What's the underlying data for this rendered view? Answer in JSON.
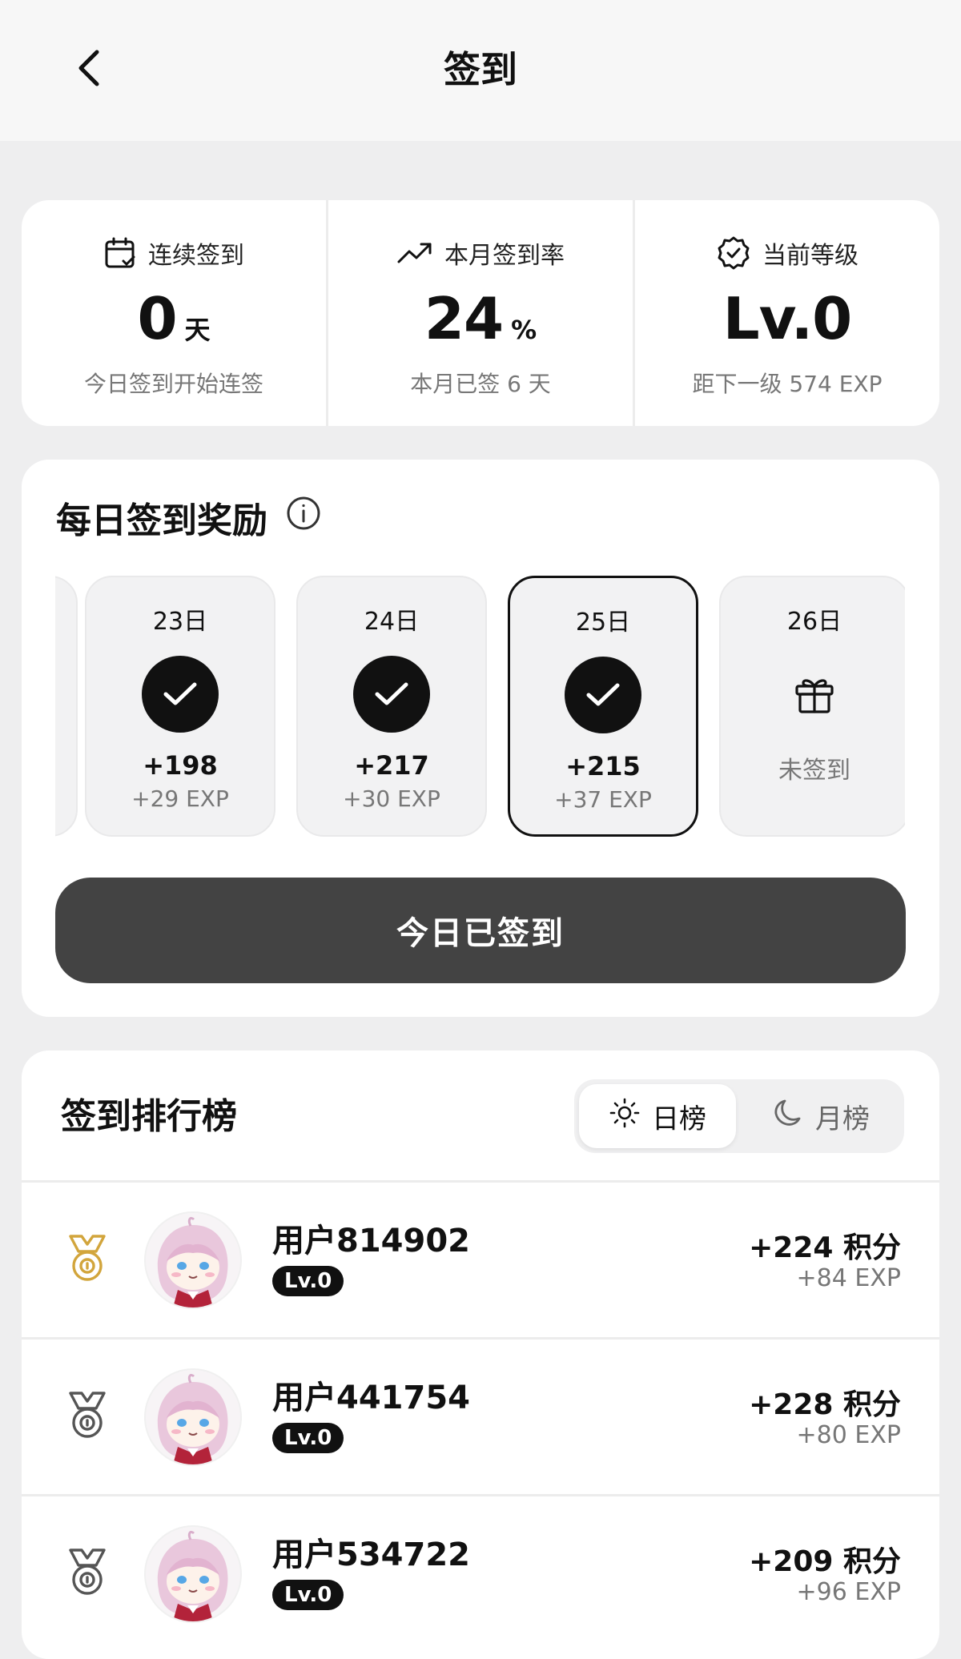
{
  "header": {
    "title": "签到",
    "back_icon": "chevron-left-icon"
  },
  "stats": [
    {
      "icon": "calendar-check-icon",
      "label": "连续签到",
      "value": "0",
      "unit": "天",
      "sub": "今日签到开始连签"
    },
    {
      "icon": "trending-up-icon",
      "label": "本月签到率",
      "value": "24",
      "unit": "%",
      "sub": "本月已签 6 天"
    },
    {
      "icon": "badge-check-icon",
      "label": "当前等级",
      "value": "Lv.0",
      "unit": "",
      "sub": "距下一级 574 EXP"
    }
  ],
  "reward": {
    "title": "每日签到奖励",
    "info_icon": "info-icon",
    "days": [
      {
        "date": "23日",
        "status": "checked",
        "points": "+198",
        "exp": "+29 EXP"
      },
      {
        "date": "24日",
        "status": "checked",
        "points": "+217",
        "exp": "+30 EXP"
      },
      {
        "date": "25日",
        "status": "checked",
        "points": "+215",
        "exp": "+37 EXP",
        "today": true
      },
      {
        "date": "26日",
        "status": "pending",
        "label": "未签到"
      }
    ],
    "button_label": "今日已签到"
  },
  "ranking": {
    "title": "签到排行榜",
    "tabs": [
      {
        "label": "日榜",
        "icon": "sun-icon",
        "active": true
      },
      {
        "label": "月榜",
        "icon": "moon-icon",
        "active": false
      }
    ],
    "rows": [
      {
        "rank": 1,
        "medal_color": "#d2a53c",
        "name": "用户814902",
        "level": "Lv.0",
        "points": "+224 积分",
        "exp": "+84 EXP"
      },
      {
        "rank": 2,
        "medal_color": "#555555",
        "name": "用户441754",
        "level": "Lv.0",
        "points": "+228 积分",
        "exp": "+80 EXP"
      },
      {
        "rank": 3,
        "medal_color": "#555555",
        "name": "用户534722",
        "level": "Lv.0",
        "points": "+209 积分",
        "exp": "+96 EXP"
      }
    ]
  }
}
